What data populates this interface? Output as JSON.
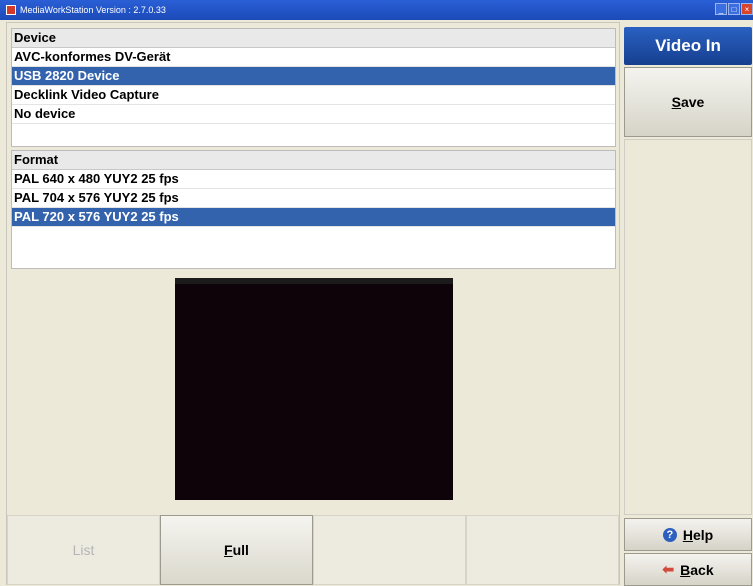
{
  "window": {
    "title": "MediaWorkStation Version : 2.7.0.33"
  },
  "device_list": {
    "header": "Device",
    "items": [
      {
        "label": "AVC-konformes DV-Gerät",
        "selected": false
      },
      {
        "label": "USB 2820 Device",
        "selected": true
      },
      {
        "label": "Decklink Video Capture",
        "selected": false
      },
      {
        "label": "No device",
        "selected": false
      }
    ]
  },
  "format_list": {
    "header": "Format",
    "items": [
      {
        "label": "PAL 640 x 480 YUY2 25 fps",
        "selected": false
      },
      {
        "label": "PAL 704 x 576 YUY2 25 fps",
        "selected": false
      },
      {
        "label": "PAL 720 x 576 YUY2 25 fps",
        "selected": true
      }
    ]
  },
  "bottom_bar": {
    "list_label": "List",
    "full_first": "F",
    "full_rest": "ull"
  },
  "right_panel": {
    "title": "Video In",
    "save_first": "S",
    "save_rest": "ave",
    "help_first": "H",
    "help_rest": "elp",
    "back_first": "B",
    "back_rest": "ack"
  },
  "colors": {
    "selection": "#3463ad",
    "title_panel": "#2a61c2",
    "preview_bg": "#0e0309"
  }
}
